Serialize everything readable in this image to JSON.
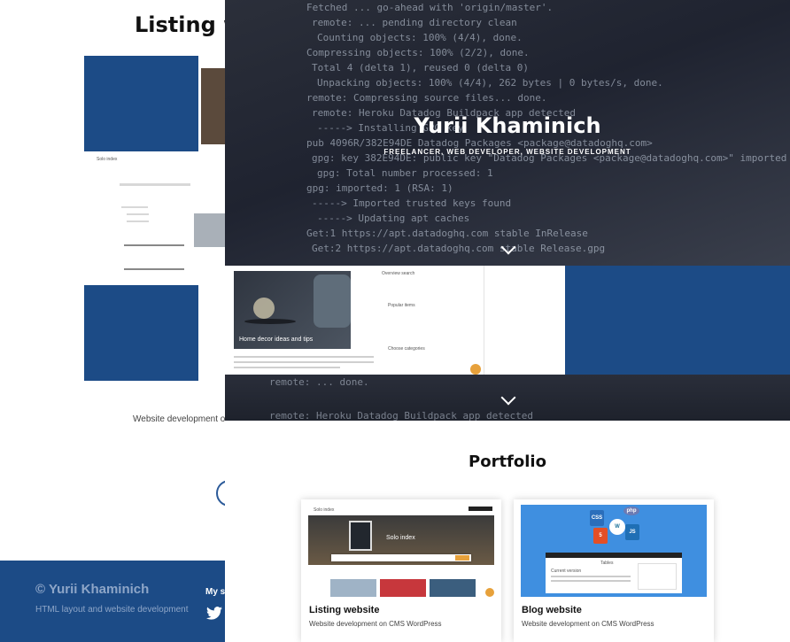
{
  "back": {
    "title": "Listing w",
    "snippet_label": "Solo index",
    "subtitle": "Website development on"
  },
  "footer": {
    "copyright": "© Yurii Khaminich",
    "description": "HTML layout and website development",
    "social_label": "My s"
  },
  "hero": {
    "name": "Yurii Khaminich",
    "tagline": "FREELANCER, WEB DEVELOPER, WEBSITE DEVELOPMENT",
    "code_lines": [
      "Fetched ... go-ahead with 'origin/master'.",
      "remote: ... pending directory clean",
      "Counting objects: 100% (4/4), done.",
      "Compressing objects: 100% (2/2), done.",
      "Total 4 (delta 1), reused 0 (delta 0)",
      "Unpacking objects: 100% (4/4), 262 bytes | 0 bytes/s, done.",
      "remote: Compressing source files... done.",
      "remote: Heroku Datadog Buildpack app detected",
      "-----> Installing GPG key",
      "       pub 4096R/382E94DE  Datadog Packages <package@datadoghq.com>",
      "gpg: key 382E94DE: public key \"Datadog Packages <package@datadoghq.com>\" imported",
      "gpg: Total number processed: 1",
      "gpg:               imported: 1  (RSA: 1)",
      "-----> Imported trusted keys found",
      "-----> Updating apt caches",
      "       Get:1 https://apt.datadoghq.com stable InRelease",
      "       Get:2 https://apt.datadoghq.com stable Release.gpg"
    ]
  },
  "mid_screenshot": {
    "post_title": "Home decor ideas and tips",
    "sidebar_heading_1": "Overview search",
    "sidebar_heading_2": "Popular items",
    "sidebar_heading_3": "Choose categories"
  },
  "strip": {
    "code_lines": [
      "remote: ... done.",
      "remote: Heroku Datadog Buildpack app detected"
    ]
  },
  "portfolio": {
    "title": "Portfolio",
    "cards": [
      {
        "title": "Listing website",
        "subtitle": "Website development on CMS WordPress",
        "banner": "Solo index",
        "logo": "Solo index"
      },
      {
        "title": "Blog website",
        "subtitle": "Website development on CMS WordPress",
        "panel_title": "Tables",
        "panel_sub": "Current version"
      }
    ]
  },
  "colors": {
    "brand_blue": "#1c4b86",
    "accent_orange": "#e7a13b",
    "blog_bg": "#3f8fe0"
  },
  "icons": [
    "chevron-down-icon",
    "twitter-icon",
    "css3-icon",
    "html5-icon",
    "wordpress-icon",
    "php-icon",
    "js-icon"
  ]
}
